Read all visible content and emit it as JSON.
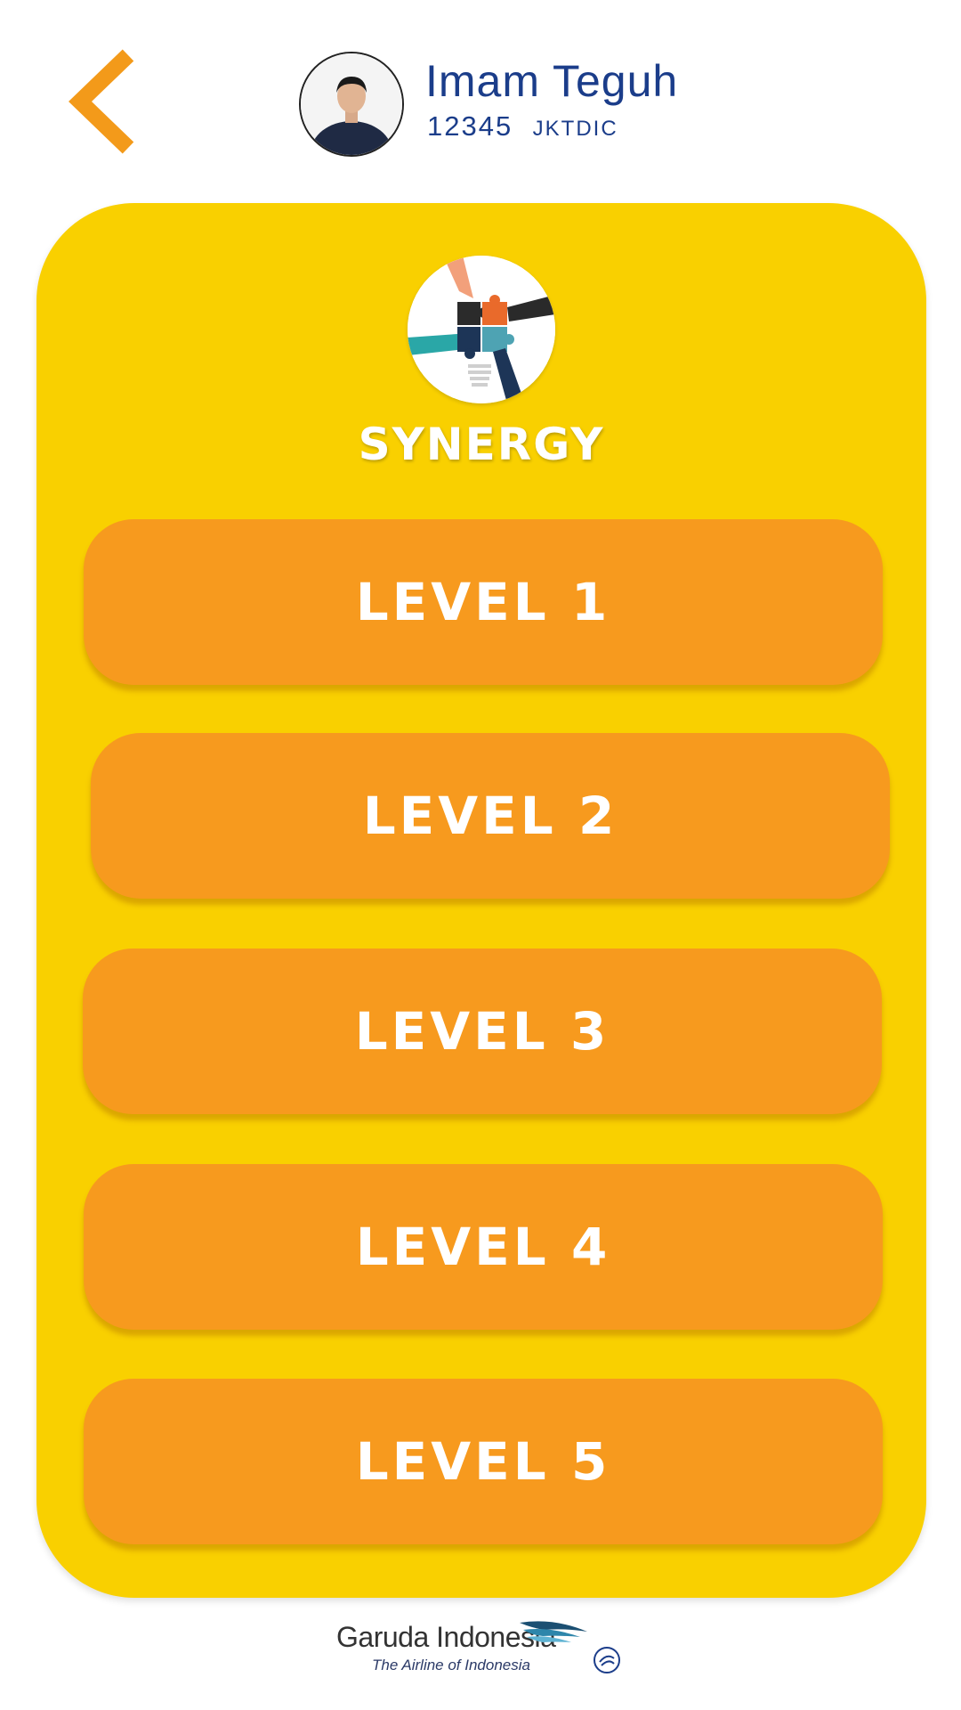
{
  "header": {
    "back_icon": "chevron-left-icon",
    "user_name": "Imam Teguh",
    "user_id": "12345",
    "user_station": "JKTDIC"
  },
  "topic": {
    "icon": "puzzle-hands-icon",
    "title": "SYNERGY"
  },
  "levels": [
    {
      "label": "LEVEL 1"
    },
    {
      "label": "LEVEL 2"
    },
    {
      "label": "LEVEL 3"
    },
    {
      "label": "LEVEL 4"
    },
    {
      "label": "LEVEL 5"
    }
  ],
  "footer": {
    "brand_name": "Garuda Indonesia",
    "brand_tagline": "The Airline of Indonesia",
    "alliance": "SKYTEAM"
  },
  "colors": {
    "accent": "#f79a1e",
    "card": "#f9d000",
    "text_blue": "#1b3d8a"
  }
}
